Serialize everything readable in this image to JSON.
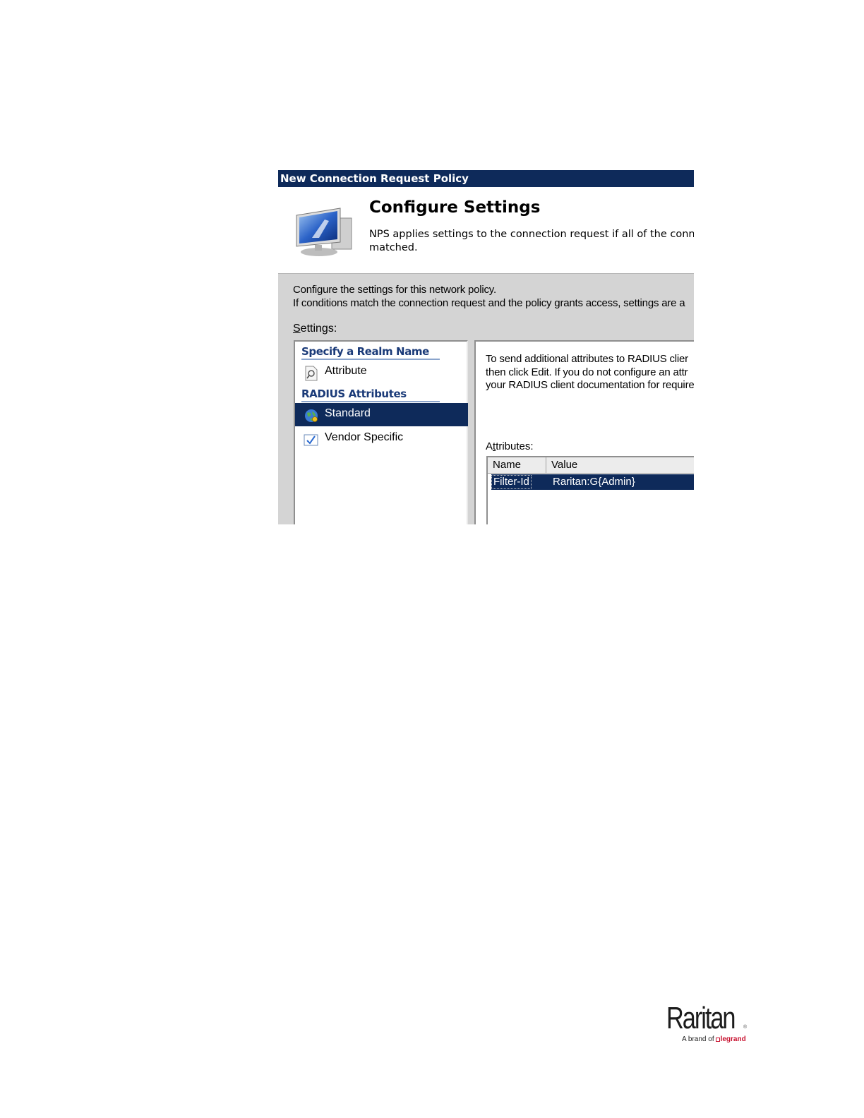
{
  "dialog": {
    "title": "New Connection Request Policy",
    "header": {
      "title": "Configure Settings",
      "description_line1": "NPS applies settings to the connection request if all of the connect",
      "description_line2": "matched."
    },
    "intro_line1": "Configure the settings for this network policy.",
    "intro_line2": "If conditions match the connection request and the policy grants access, settings are a",
    "settings_label_underlined": "S",
    "settings_label_rest": "ettings:",
    "tree": {
      "groups": [
        {
          "label": "Specify a Realm Name",
          "items": [
            {
              "label": "Attribute",
              "icon": "magnifier-page-icon"
            }
          ]
        },
        {
          "label": "RADIUS Attributes",
          "items": [
            {
              "label": "Standard",
              "icon": "globe-icon",
              "selected": true
            },
            {
              "label": "Vendor Specific",
              "icon": "checkbox-icon"
            }
          ]
        }
      ]
    },
    "right": {
      "desc_line1": "To send additional attributes to RADIUS clier",
      "desc_line2": "then click Edit. If you do not configure an attr",
      "desc_line3": "your RADIUS client documentation for require",
      "attributes_label_pre": "A",
      "attributes_label_underlined": "t",
      "attributes_label_rest": "tributes:",
      "columns": [
        "Name",
        "Value"
      ],
      "rows": [
        {
          "name": "Filter-Id",
          "value": "Raritan:G{Admin}"
        }
      ]
    }
  },
  "brand": {
    "wordmark": "Raritan",
    "registered": "®",
    "tagline_prefix": "A brand of",
    "tagline_brand": "legrand",
    "colors": {
      "legrand_red": "#c8102e",
      "selection_navy": "#0e2a5a"
    }
  }
}
